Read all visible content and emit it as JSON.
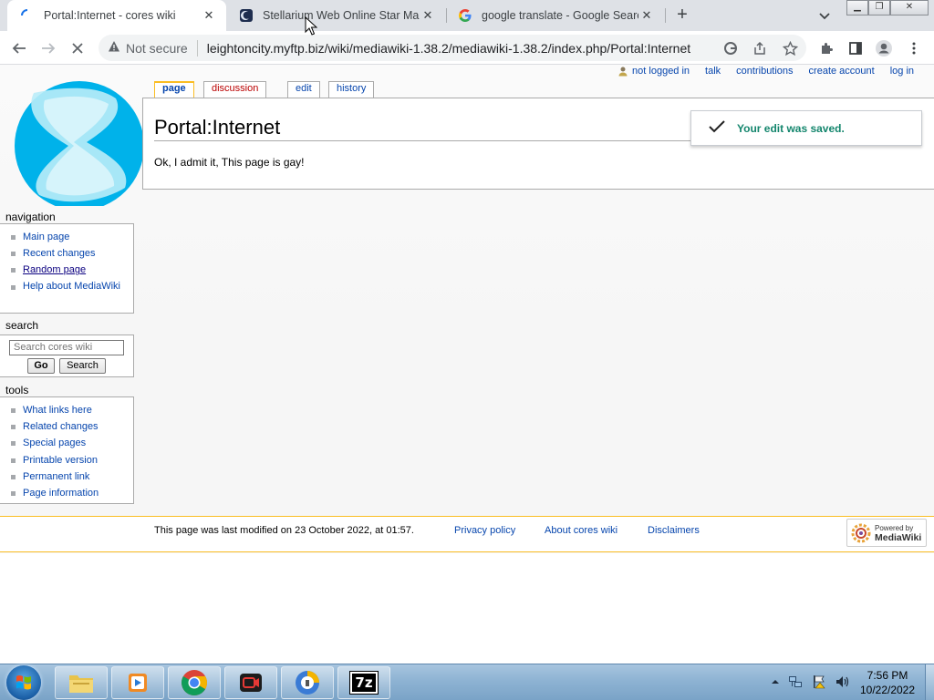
{
  "browser": {
    "tabs": [
      {
        "title": "Portal:Internet - cores wiki",
        "icon": "loading-spinner-icon",
        "active": true
      },
      {
        "title": "Stellarium Web Online Star Map",
        "icon": "stellarium-icon",
        "active": false
      },
      {
        "title": "google translate - Google Search",
        "icon": "google-icon",
        "active": false
      }
    ],
    "security_label": "Not secure",
    "url": "leightoncity.myftp.biz/wiki/mediawiki-1.38.2/mediawiki-1.38.2/index.php/Portal:Internet"
  },
  "wiki": {
    "personal_tools": [
      "not logged in",
      "talk",
      "contributions",
      "create account",
      "log in"
    ],
    "content_tabs": {
      "page": "page",
      "discussion": "discussion",
      "edit": "edit",
      "history": "history"
    },
    "title": "Portal:Internet",
    "body": "Ok, I admit it, This page is gay!",
    "notification": "Your edit was saved.",
    "navigation": {
      "heading": "navigation",
      "items": [
        "Main page",
        "Recent changes",
        "Random page",
        "Help about MediaWiki"
      ]
    },
    "search": {
      "heading": "search",
      "placeholder": "Search cores wiki",
      "go_label": "Go",
      "search_label": "Search"
    },
    "tools": {
      "heading": "tools",
      "items": [
        "What links here",
        "Related changes",
        "Special pages",
        "Printable version",
        "Permanent link",
        "Page information"
      ]
    },
    "footer": {
      "last_modified": "This page was last modified on 23 October 2022, at 01:57.",
      "links": [
        "Privacy policy",
        "About cores wiki",
        "Disclaimers"
      ],
      "powered_by": "Powered by",
      "powered_name": "MediaWiki"
    }
  },
  "taskbar": {
    "apps": [
      "file-explorer-icon",
      "media-player-icon",
      "chrome-icon",
      "screen-recorder-icon",
      "vpn-icon",
      "7zip-icon"
    ],
    "seven_zip_label": "7z",
    "time": "7:56 PM",
    "date": "10/22/2022"
  },
  "colors": {
    "link": "#0645ad",
    "new_link": "#ba0000",
    "success": "#14866d",
    "tab_accent": "#fabd23"
  }
}
